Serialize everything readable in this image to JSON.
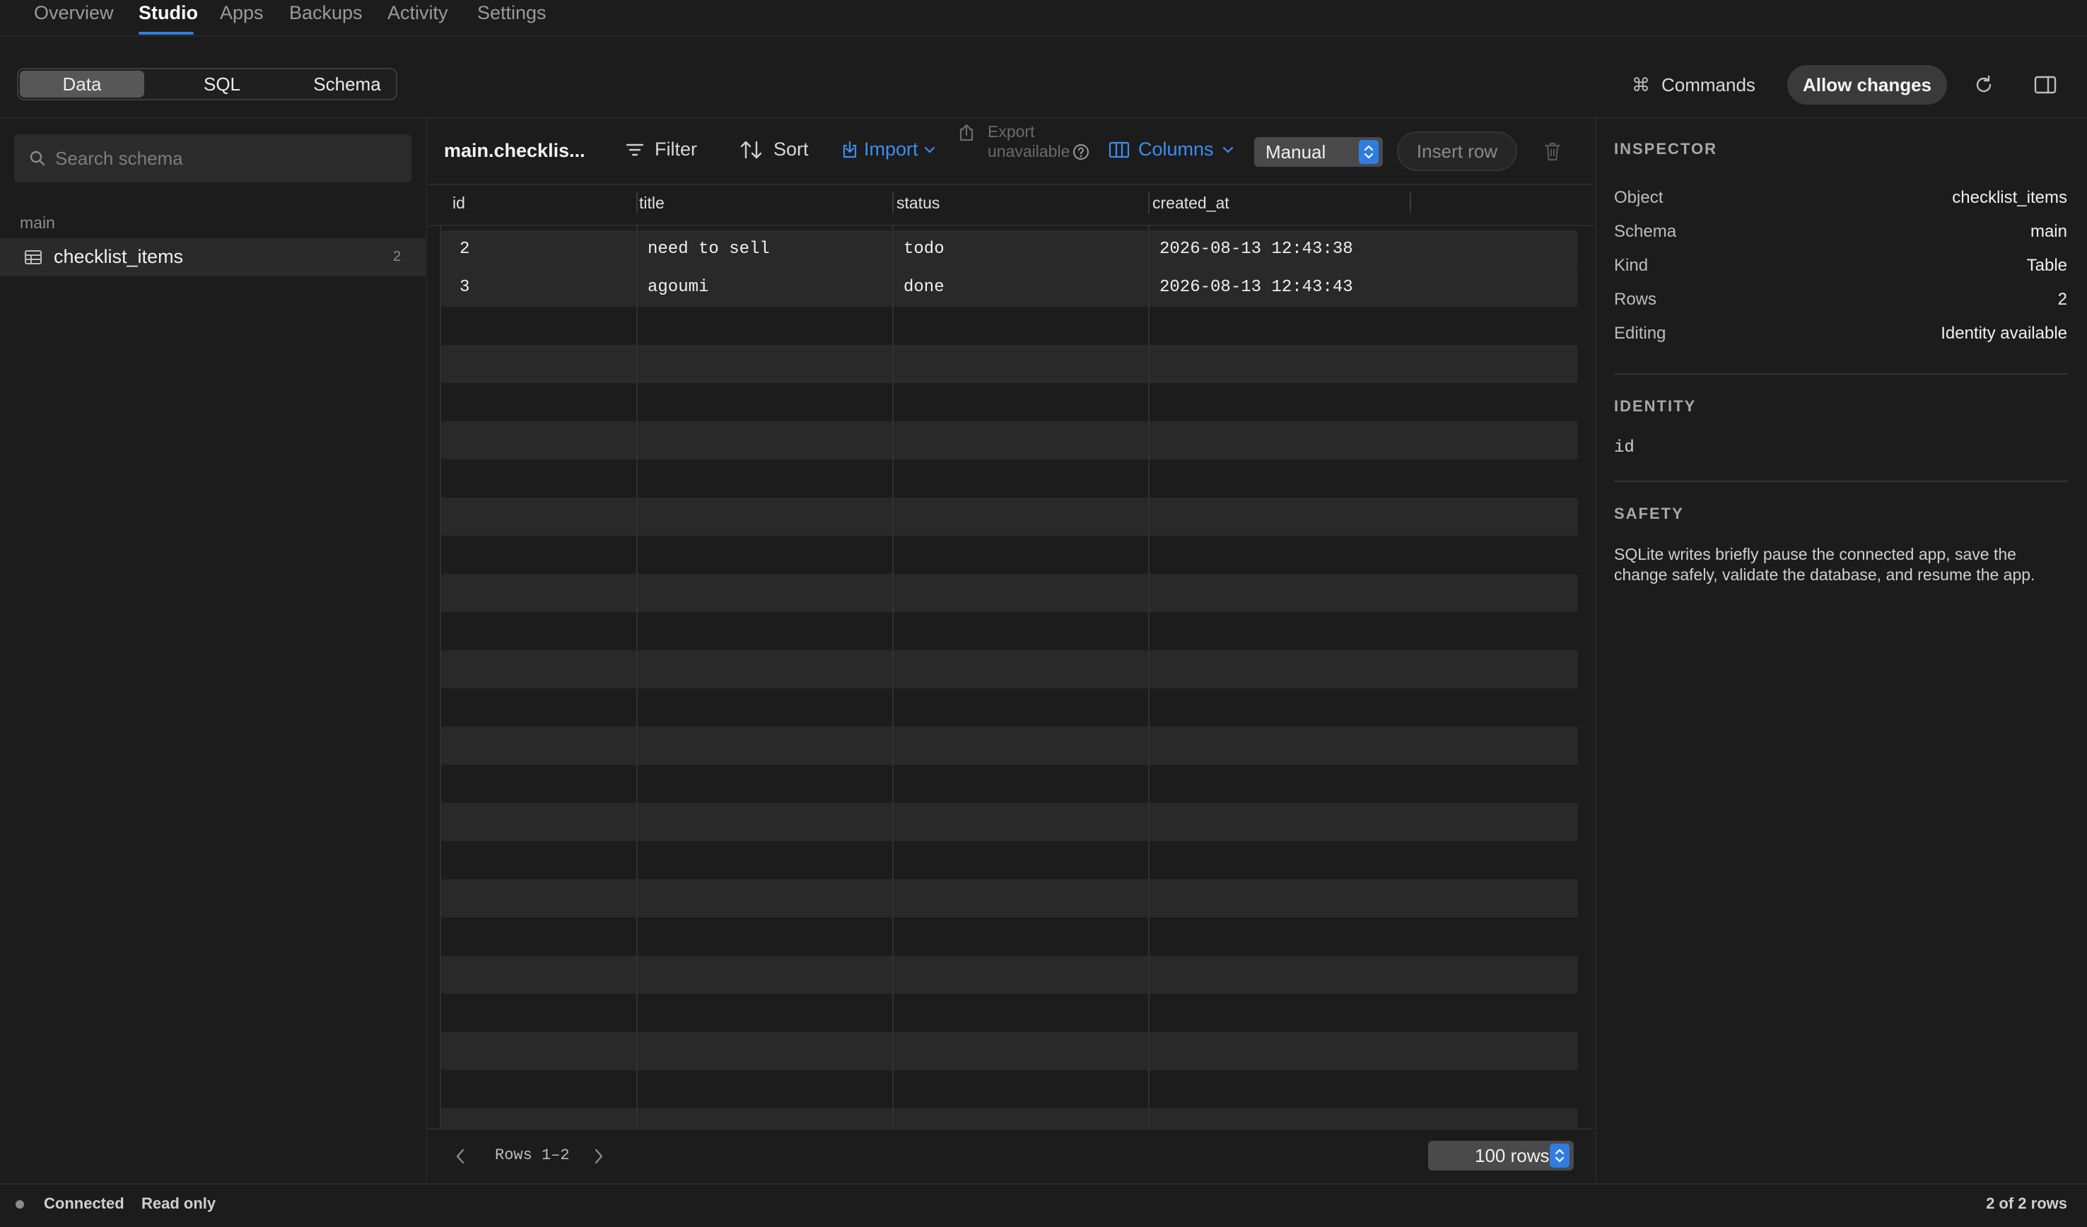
{
  "nav": {
    "tabs": [
      {
        "label": "Overview"
      },
      {
        "label": "Studio",
        "active": true
      },
      {
        "label": "Apps"
      },
      {
        "label": "Backups"
      },
      {
        "label": "Activity"
      },
      {
        "label": "Settings"
      }
    ]
  },
  "modes": {
    "items": [
      {
        "label": "Data",
        "active": true
      },
      {
        "label": "SQL"
      },
      {
        "label": "Schema"
      }
    ]
  },
  "actions": {
    "commands_label": "Commands",
    "allow_changes_label": "Allow changes"
  },
  "sidebar": {
    "search_placeholder": "Search schema",
    "schema_name": "main",
    "tables": [
      {
        "name": "checklist_items",
        "count": "2"
      }
    ]
  },
  "toolbar": {
    "title": "main.checklis...",
    "filter_label": "Filter",
    "sort_label": "Sort",
    "import_label": "Import",
    "export_label": "Export unavailable",
    "columns_label": "Columns",
    "mode_select": "Manual",
    "insert_row_label": "Insert row"
  },
  "grid": {
    "columns": [
      "id",
      "title",
      "status",
      "created_at"
    ],
    "rows": [
      [
        "2",
        "need to sell",
        "todo",
        "2026-08-13 12:43:38"
      ],
      [
        "3",
        "agoumi",
        "done",
        "2026-08-13 12:43:43"
      ]
    ]
  },
  "pagination": {
    "range": "Rows 1–2",
    "page_size": "100 rows"
  },
  "inspector": {
    "title": "INSPECTOR",
    "fields": [
      {
        "key": "Object",
        "value": "checklist_items"
      },
      {
        "key": "Schema",
        "value": "main"
      },
      {
        "key": "Kind",
        "value": "Table"
      },
      {
        "key": "Rows",
        "value": "2"
      },
      {
        "key": "Editing",
        "value": "Identity available"
      }
    ],
    "identity_title": "IDENTITY",
    "identity_value": "id",
    "safety_title": "SAFETY",
    "safety_text": "SQLite writes briefly pause the connected app, save the change safely, validate the database, and resume the app."
  },
  "status": {
    "connection": "Connected",
    "mode": "Read only",
    "count": "2 of 2 rows"
  },
  "colors": {
    "accent": "#2f7de1",
    "background": "#1c1c1c"
  }
}
